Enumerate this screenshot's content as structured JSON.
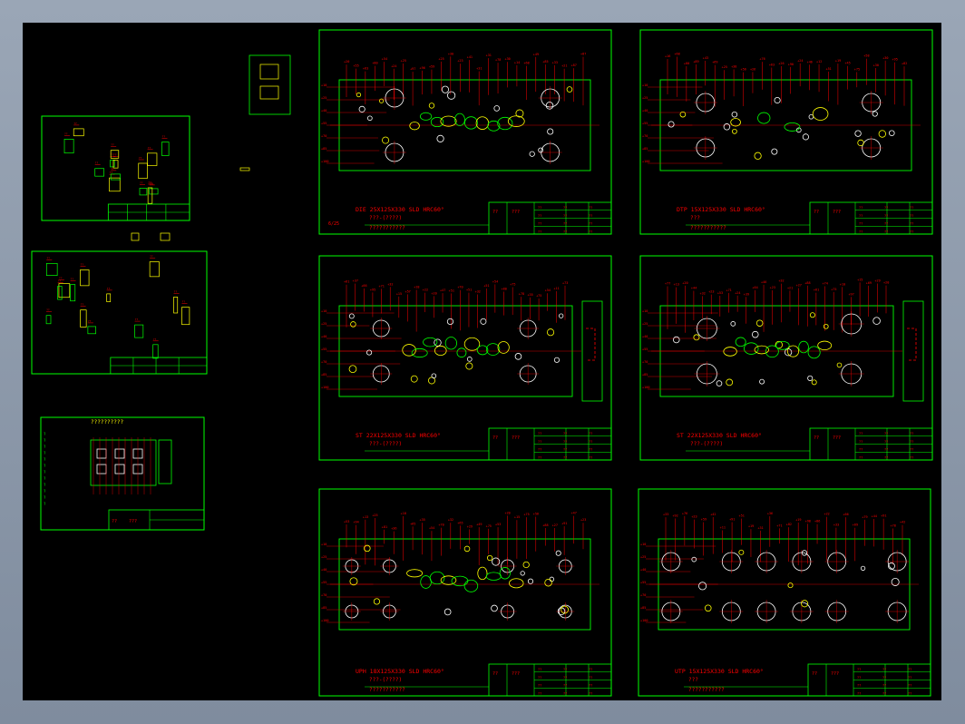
{
  "colors": {
    "background": "#000000",
    "frame": "#8e9aab",
    "border": "#00ff00",
    "dims": "#ff0000",
    "holes": "#ffffff",
    "accent": "#ffff00",
    "part": "#00ffff"
  },
  "sheets": [
    {
      "id": "die",
      "title": "DIE 25X125X330 SLD HRC60°",
      "subtitle": "???-(????)",
      "note": "???????????",
      "scale": "6/25",
      "tb": [
        "??",
        "???"
      ]
    },
    {
      "id": "dtp",
      "title": "DTP 15X125X330 SLD HRC60°",
      "subtitle": "???",
      "note": "???????????",
      "tb": [
        "??",
        "???"
      ]
    },
    {
      "id": "st1",
      "title": "ST 22X125X330 SLD HRC60°",
      "subtitle": "???-(????)",
      "note": "",
      "tb": [
        "??",
        "???"
      ]
    },
    {
      "id": "st2",
      "title": "ST 22X125X330 SLD HRC60°",
      "subtitle": "???-(????)",
      "note": "",
      "tb": [
        "??",
        "???"
      ]
    },
    {
      "id": "uph",
      "title": "UPH 18X125X330 SLD HRC60°",
      "subtitle": "???-(????)",
      "note": "???????????",
      "tb": [
        "??",
        "???"
      ]
    },
    {
      "id": "utp",
      "title": "UTP 15X125X330 SLD HRC60°",
      "subtitle": "???",
      "note": "???????????",
      "tb": [
        "??",
        "???"
      ]
    }
  ],
  "small_sheets": {
    "strip_header": "??????????",
    "strip_tb": [
      "??",
      "???"
    ]
  }
}
